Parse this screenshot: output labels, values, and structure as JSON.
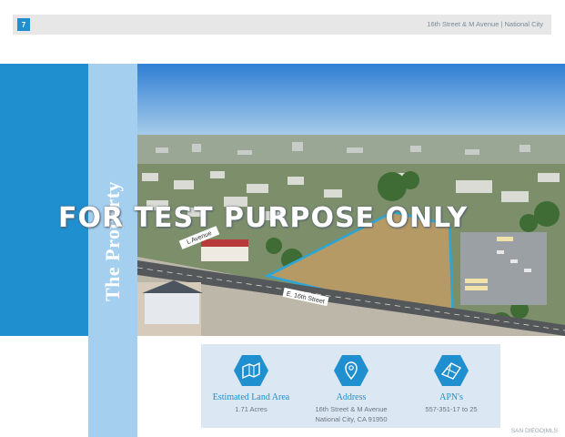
{
  "header": {
    "page_number": "7",
    "title": "16th Street & M Avenue | National City"
  },
  "section_title": "The Property",
  "watermark": "FOR TEST PURPOSE ONLY",
  "photo": {
    "street_labels": [
      "L Avenue",
      "E. 16th Street"
    ]
  },
  "info": [
    {
      "icon": "land-map-icon",
      "label": "Estimated Land Area",
      "value": "1.71 Acres"
    },
    {
      "icon": "location-pin-icon",
      "label": "Address",
      "value": "16th Street & M Avenue",
      "value2": "National City, CA 91950"
    },
    {
      "icon": "parcel-map-icon",
      "label": "APN's",
      "value": "557-351-17 to 25"
    }
  ],
  "footer": {
    "mls": "SAN DIEGO|MLS"
  },
  "colors": {
    "accent": "#1f8fcf",
    "accent_light": "#a4cfee",
    "panel": "#dbe7f2",
    "lot_outline": "#2aa6d8"
  }
}
